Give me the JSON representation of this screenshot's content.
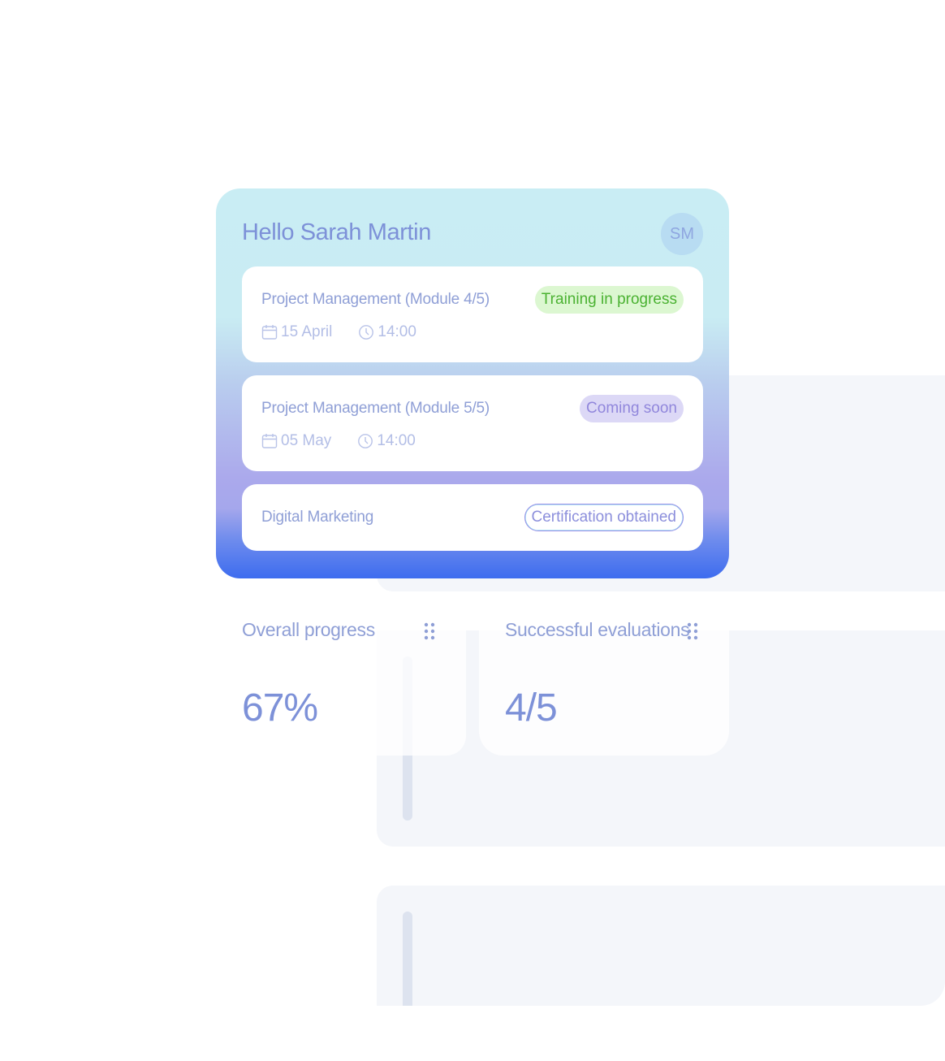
{
  "greeting": "Hello Sarah Martin",
  "avatar_initials": "SM",
  "courses": [
    {
      "title": "Project Management (Module 4/5)",
      "status": "Training in progress",
      "date": "15 April",
      "time": "14:00"
    },
    {
      "title": "Project Management (Module 5/5)",
      "status": "Coming soon",
      "date": "05 May",
      "time": "14:00"
    },
    {
      "title": "Digital Marketing",
      "status": "Certification obtained"
    }
  ],
  "stats": {
    "overall_progress": {
      "label": "Overall progress",
      "value": "67%"
    },
    "successful_evaluations": {
      "label": "Successful evaluations",
      "value": "4/5"
    }
  },
  "colors": {
    "text_primary": "#7d91d8",
    "badge_progress": "#4bb232",
    "badge_soon": "#9187dc",
    "gradient_top": "#c9edf4",
    "gradient_bottom": "#3d6cef"
  },
  "icons": [
    "calendar-icon",
    "clock-icon",
    "drag-handle-icon"
  ]
}
